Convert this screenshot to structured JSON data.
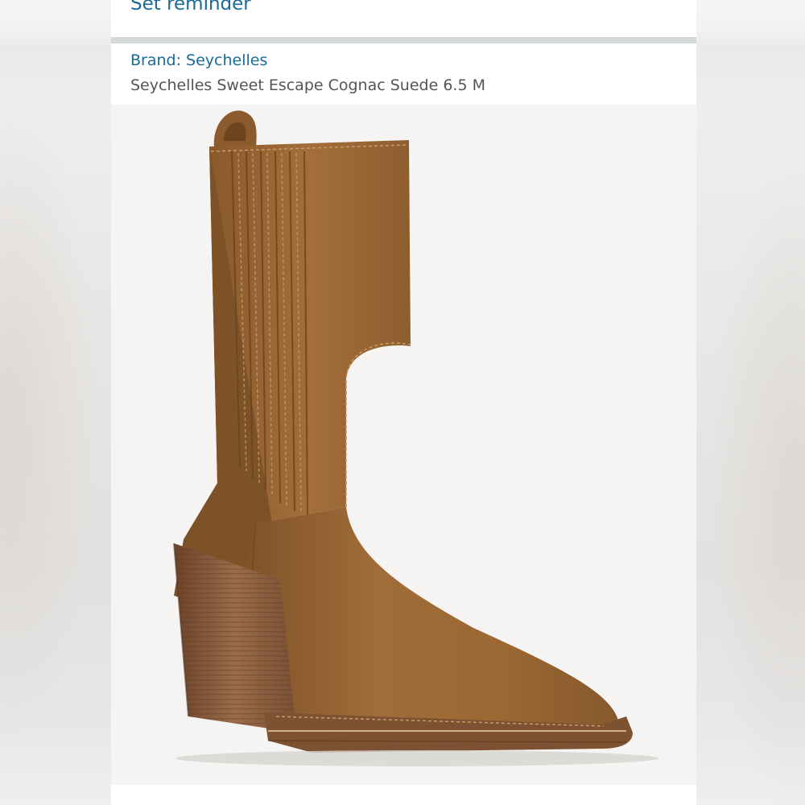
{
  "reminder": {
    "label": "Set reminder"
  },
  "product": {
    "brand_label": "Brand: Seychelles",
    "title": "Seychelles Sweet Escape Cognac Suede 6.5 M",
    "image_icon": "cognac-suede-ankle-boot-photo"
  },
  "colors": {
    "link": "#1a6a96",
    "title_text": "#555555",
    "divider": "#d5d9d9",
    "suede": "#9c6a35",
    "heel": "#8a5a38"
  }
}
